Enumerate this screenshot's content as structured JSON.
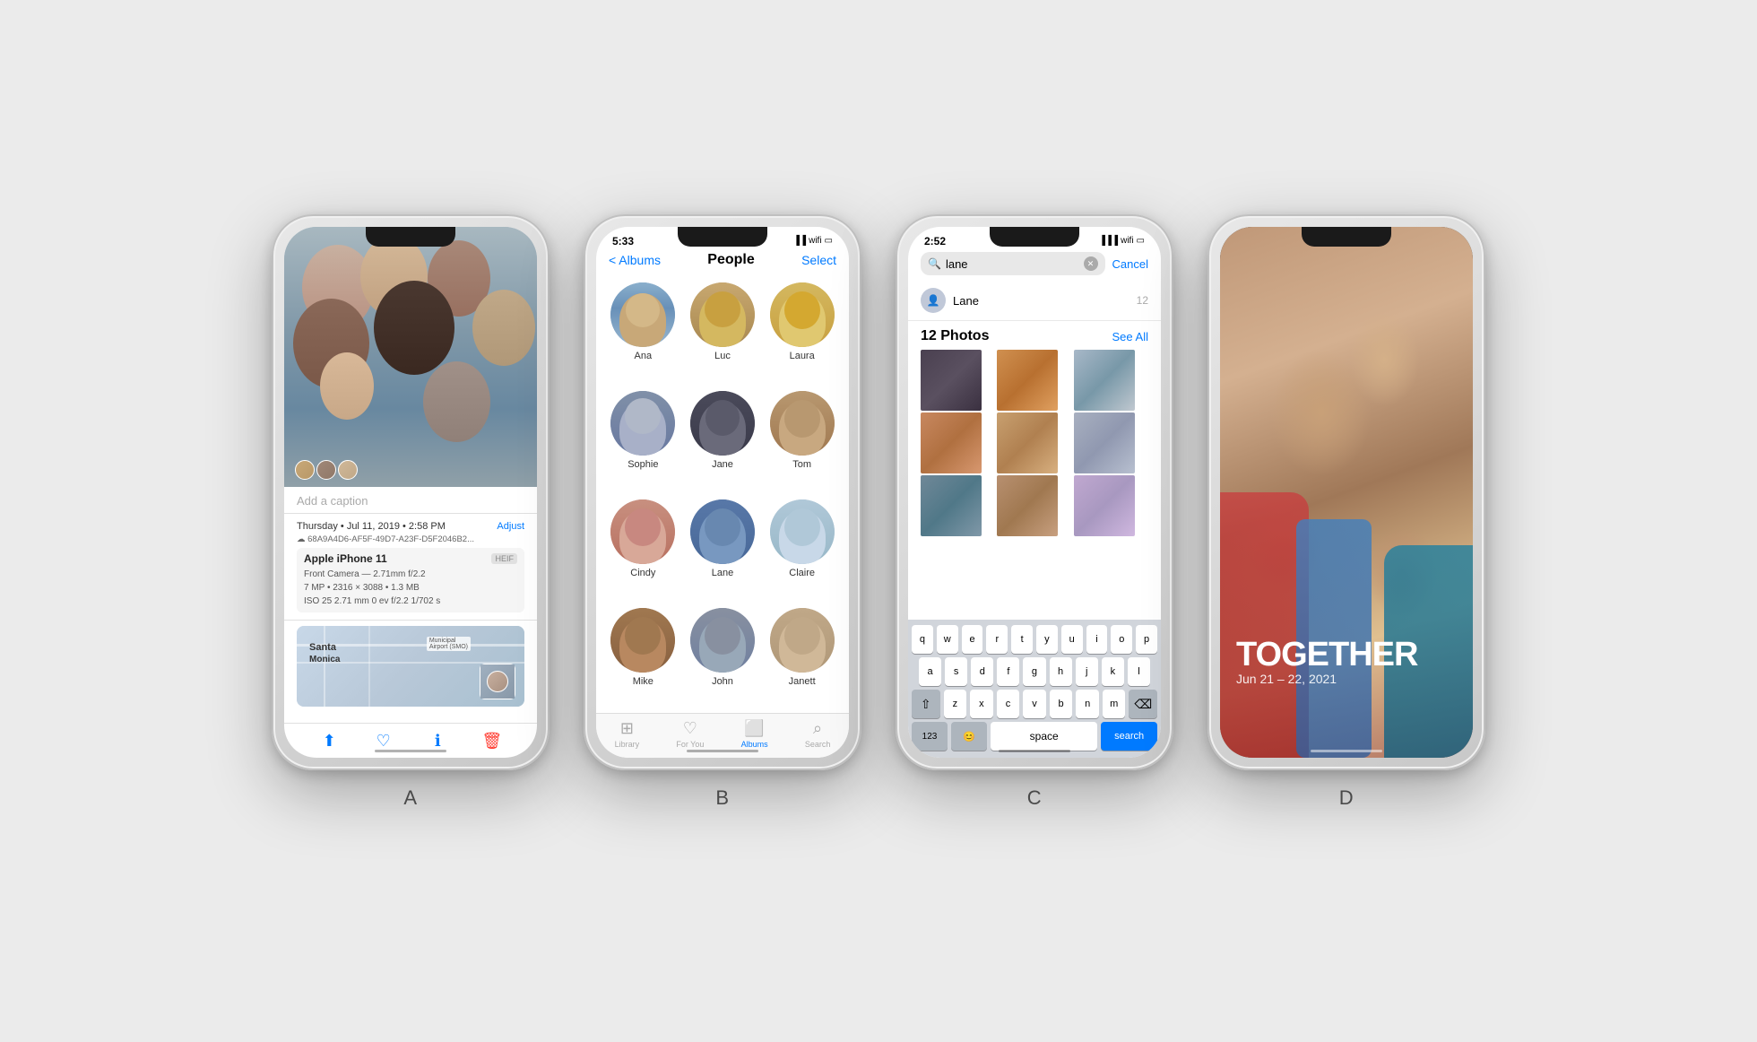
{
  "scene": {
    "background": "#ebebeb"
  },
  "phones": [
    {
      "label": "A",
      "type": "info",
      "status_time": "",
      "content": {
        "caption_placeholder": "Add a caption",
        "date_time": "Thursday • Jul 11, 2019 • 2:58 PM",
        "adjust": "Adjust",
        "icloud_id": "☁  68A9A4D6-AF5F-49D7-A23F-D5F2046B2...",
        "device": "Apple iPhone 11",
        "badge_heif": "HEIF",
        "camera_detail": "Front Camera — 2.71mm f/2.2",
        "photo_detail": "7 MP  •  2316 × 3088  •  1.3 MB",
        "exif": "ISO 25    2.71 mm    0 ev    f/2.2    1/702 s",
        "map_label": "Santa",
        "map_label2": "Monica",
        "airport_label": "Municipal Airport (SMO)"
      }
    },
    {
      "label": "B",
      "type": "people",
      "status_time": "5:33",
      "content": {
        "nav_back": "< Albums",
        "nav_title": "People",
        "nav_action": "Select",
        "people": [
          {
            "name": "Ana",
            "av": "av-ana"
          },
          {
            "name": "Luc",
            "av": "av-luc"
          },
          {
            "name": "Laura",
            "av": "av-laura"
          },
          {
            "name": "Sophie",
            "av": "av-sophie"
          },
          {
            "name": "Jane",
            "av": "av-jane"
          },
          {
            "name": "Tom",
            "av": "av-tom"
          },
          {
            "name": "Cindy",
            "av": "av-cindy"
          },
          {
            "name": "Lane",
            "av": "av-lane"
          },
          {
            "name": "Claire",
            "av": "av-claire"
          },
          {
            "name": "Mike",
            "av": "av-mike"
          },
          {
            "name": "John",
            "av": "av-john"
          },
          {
            "name": "Janett",
            "av": "av-janett"
          }
        ],
        "tabs": [
          "Library",
          "For You",
          "Albums",
          "Search"
        ],
        "active_tab": 2
      }
    },
    {
      "label": "C",
      "type": "search",
      "status_time": "2:52",
      "content": {
        "search_text": "lane",
        "cancel_label": "Cancel",
        "person_result": "Lane",
        "photo_count": "12",
        "section_title": "12 Photos",
        "see_all": "See All",
        "keyboard_rows": [
          [
            "q",
            "w",
            "e",
            "r",
            "t",
            "y",
            "u",
            "i",
            "o",
            "p"
          ],
          [
            "a",
            "s",
            "d",
            "f",
            "g",
            "h",
            "j",
            "k",
            "l"
          ],
          [
            "z",
            "x",
            "c",
            "v",
            "b",
            "n",
            "m"
          ],
          [
            "123",
            "😊",
            "space",
            "search"
          ]
        ]
      }
    },
    {
      "label": "D",
      "type": "memory",
      "content": {
        "title": "TOGETHER",
        "date_range": "Jun 21 – 22, 2021"
      }
    }
  ]
}
